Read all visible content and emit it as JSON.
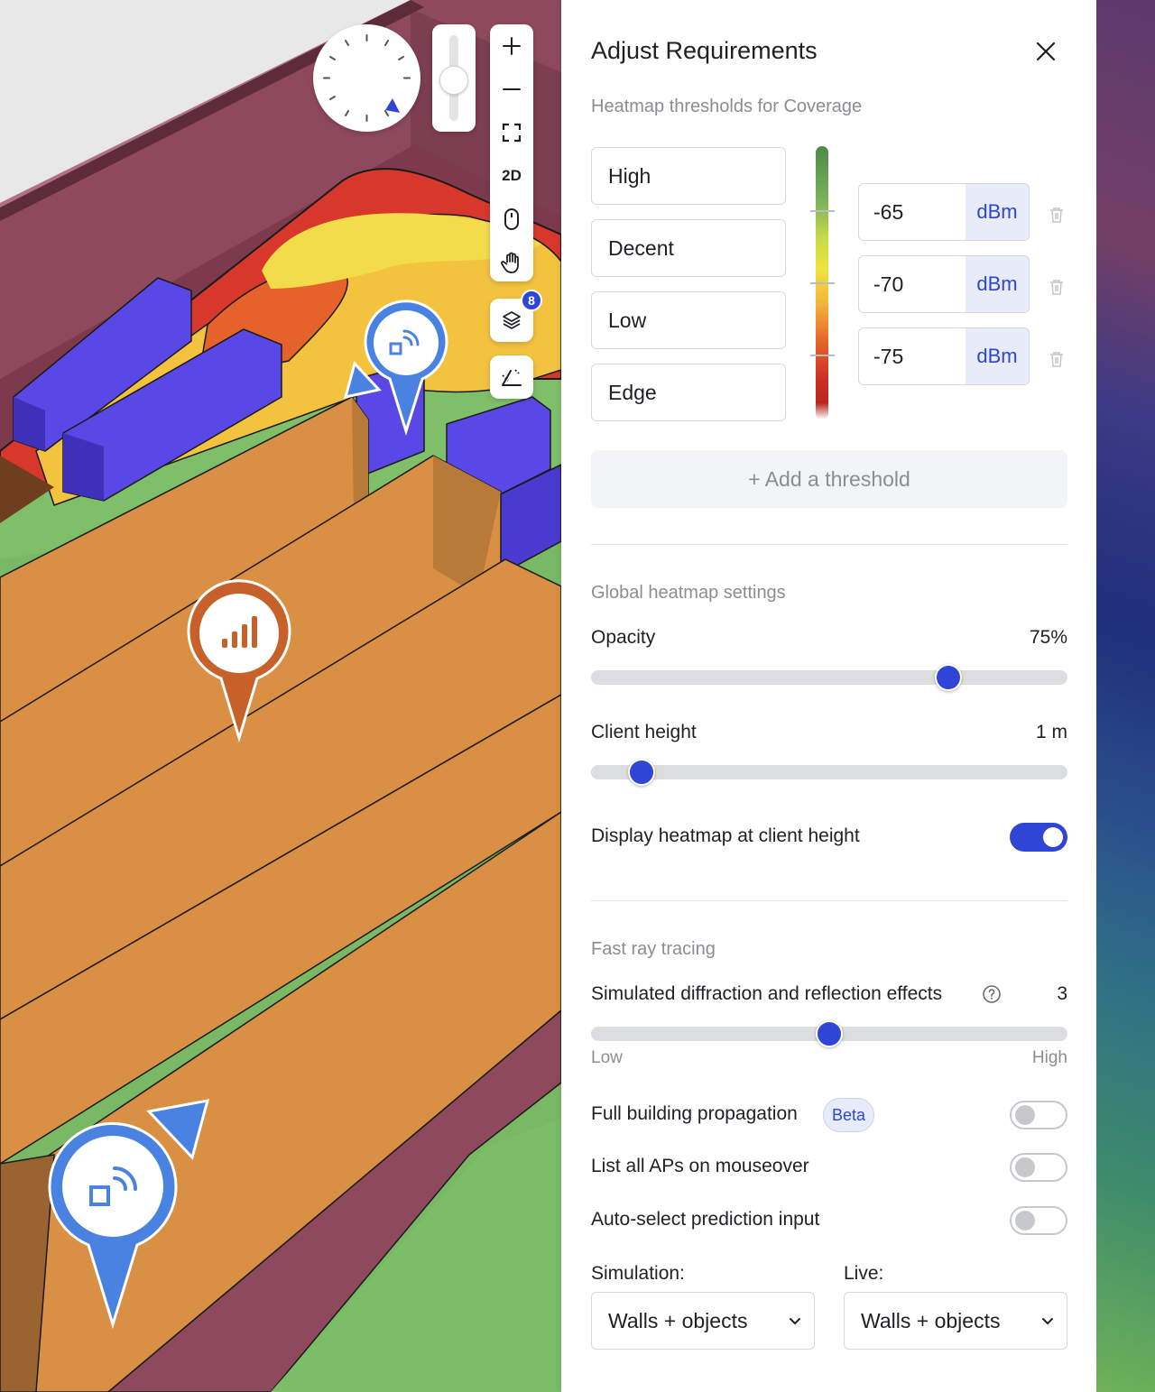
{
  "viewport": {
    "mode_2d_label": "2D",
    "layers_badge": "8"
  },
  "panel": {
    "title": "Adjust Requirements",
    "coverage_section": "Heatmap thresholds for Coverage",
    "thresholds": [
      {
        "name": "High"
      },
      {
        "name": "Decent"
      },
      {
        "name": "Low"
      },
      {
        "name": "Edge"
      }
    ],
    "boundaries": [
      {
        "value": "-65",
        "unit": "dBm"
      },
      {
        "value": "-70",
        "unit": "dBm"
      },
      {
        "value": "-75",
        "unit": "dBm"
      }
    ],
    "add_threshold": "+ Add a threshold",
    "global_section": "Global heatmap settings",
    "opacity": {
      "label": "Opacity",
      "value": "75%",
      "fraction": 0.75
    },
    "client_height": {
      "label": "Client height",
      "value": "1 m",
      "fraction": 0.106
    },
    "display_at_client_height": {
      "label": "Display heatmap at client height",
      "on": true
    },
    "ray_section": "Fast ray tracing",
    "diffraction": {
      "label": "Simulated diffraction and reflection effects",
      "value": "3",
      "fraction": 0.5,
      "low": "Low",
      "high": "High"
    },
    "full_building": {
      "label": "Full building propagation",
      "badge": "Beta",
      "on": false
    },
    "list_aps": {
      "label": "List all APs on mouseover",
      "on": false
    },
    "auto_select": {
      "label": "Auto-select prediction input",
      "on": false
    },
    "simulation": {
      "label": "Simulation:",
      "value": "Walls + objects"
    },
    "live": {
      "label": "Live:",
      "value": "Walls + objects"
    }
  },
  "colors": {
    "accent": "#2e45d6",
    "ap_pin": "#4a82e2",
    "client_pin": "#c8602a",
    "rack_blue": "#5a48e6",
    "shelf_orange": "#d98f44",
    "wall_maroon": "#8e4a5c"
  }
}
